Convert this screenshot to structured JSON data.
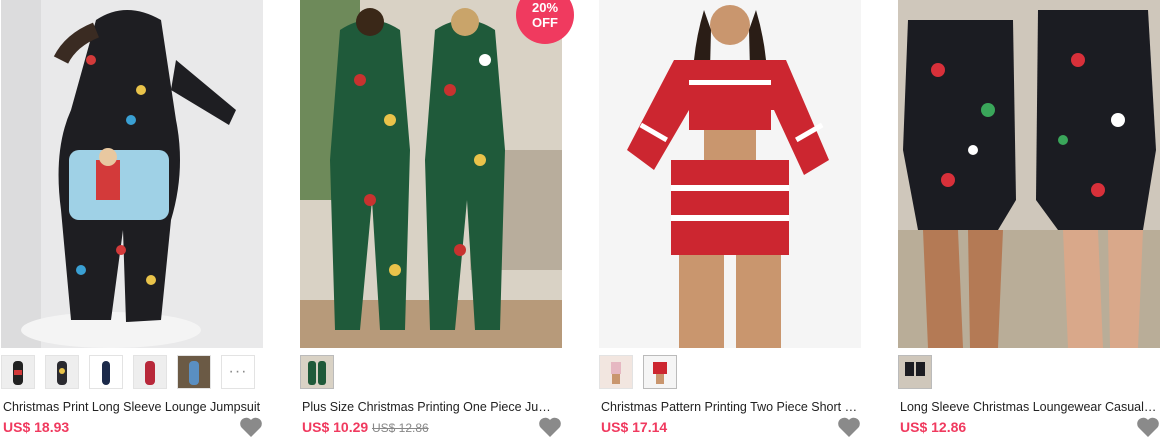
{
  "products": [
    {
      "name": "Christmas Print Long Sleeve Lounge Jumpsuit",
      "price": "US$ 18.93",
      "old_price": "",
      "badge": "",
      "thumbnail_count": 5,
      "more_label": "···",
      "colors": {
        "bg": "#e9e9ea",
        "outfit": "#1e1e22",
        "accent": "#d33a3a"
      }
    },
    {
      "name": "Plus Size Christmas Printing One Piece Jumpsuit",
      "price": "US$ 10.29",
      "old_price": "US$ 12.86",
      "badge": "20%\nOFF",
      "thumbnail_count": 1,
      "colors": {
        "bg": "#d9d2c5",
        "outfit": "#1f5a3a",
        "accent": "#c8322f"
      }
    },
    {
      "name": "Christmas Pattern Printing Two Piece Short Set",
      "price": "US$ 17.14",
      "old_price": "",
      "badge": "",
      "thumbnail_count": 2,
      "colors": {
        "bg": "#f5f5f5",
        "outfit": "#cc2630",
        "accent": "#ffffff"
      }
    },
    {
      "name": "Long Sleeve Christmas Loungewear Casual Romper",
      "price": "US$ 12.86",
      "old_price": "",
      "badge": "",
      "thumbnail_count": 1,
      "colors": {
        "bg": "#cfc7bb",
        "outfit": "#1b1c22",
        "accent": "#d8303a"
      }
    }
  ],
  "icons": {
    "favorite": "heart-icon",
    "more": "more-dots-icon"
  },
  "theme": {
    "price_color": "#f03a5f",
    "heart_color": "#8a8a8a"
  }
}
